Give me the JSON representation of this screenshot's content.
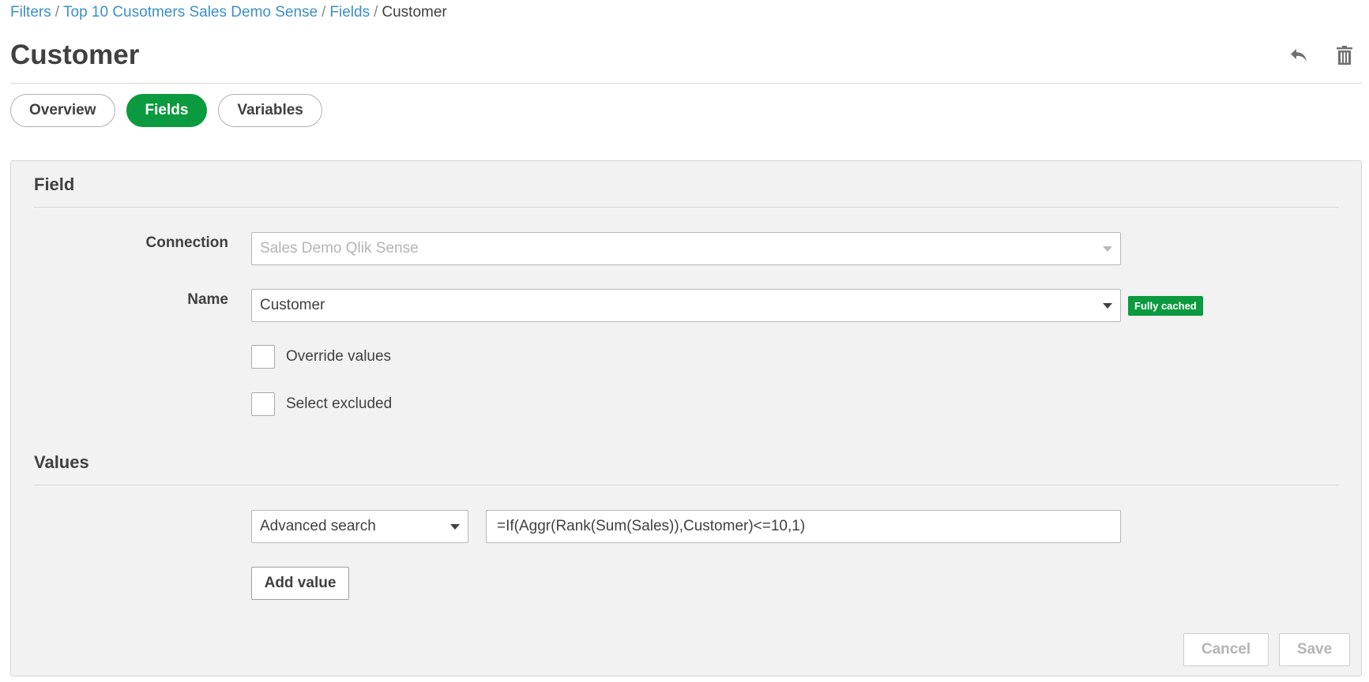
{
  "breadcrumb": {
    "items": [
      {
        "label": "Filters"
      },
      {
        "label": "Top 10 Cusotmers Sales Demo Sense"
      },
      {
        "label": "Fields"
      }
    ],
    "separator": "/",
    "current": "Customer"
  },
  "page": {
    "title": "Customer"
  },
  "header_actions": {
    "undo_icon": "undo-icon",
    "delete_icon": "trash-icon"
  },
  "tabs": [
    {
      "label": "Overview",
      "active": false
    },
    {
      "label": "Fields",
      "active": true
    },
    {
      "label": "Variables",
      "active": false
    }
  ],
  "field_section": {
    "title": "Field",
    "connection_label": "Connection",
    "connection_value": "Sales Demo Qlik Sense",
    "name_label": "Name",
    "name_value": "Customer",
    "cache_badge": "Fully cached",
    "override_values_label": "Override values",
    "override_values_checked": false,
    "select_excluded_label": "Select excluded",
    "select_excluded_checked": false
  },
  "values_section": {
    "title": "Values",
    "search_type": "Advanced search",
    "expression": "=If(Aggr(Rank(Sum(Sales)),Customer)<=10,1)",
    "add_value_label": "Add value"
  },
  "footer": {
    "cancel_label": "Cancel",
    "save_label": "Save"
  },
  "colors": {
    "accent": "#0b9a3f",
    "link": "#3a8fc5",
    "text": "#404040"
  }
}
